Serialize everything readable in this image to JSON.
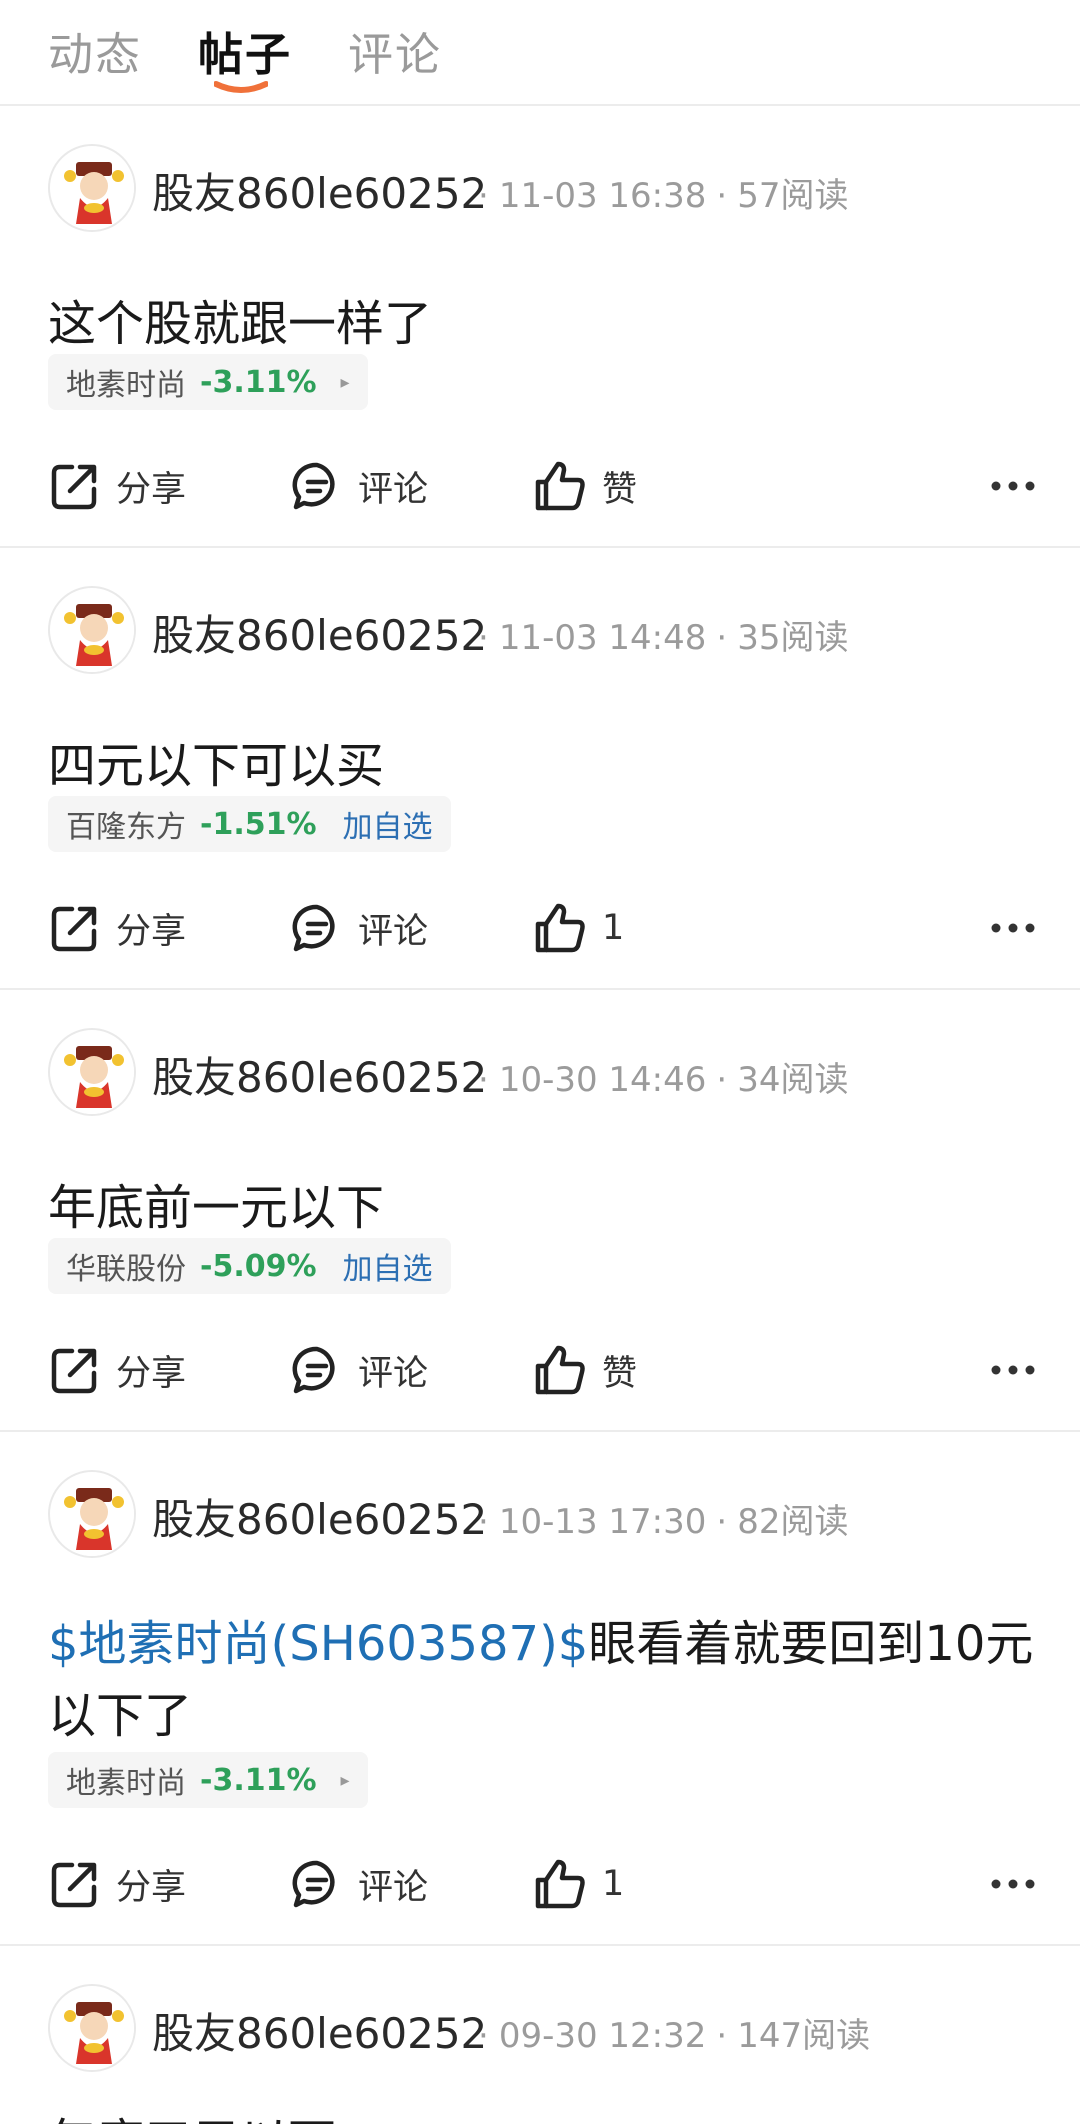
{
  "tabs": [
    {
      "label": "动态",
      "active": false
    },
    {
      "label": "帖子",
      "active": true
    },
    {
      "label": "评论",
      "active": false
    }
  ],
  "accent_color": "#f0713a",
  "posts": [
    {
      "author": "股友860le60252",
      "time": "11-03 16:38",
      "reads": "57阅读",
      "content_link": "",
      "content": "这个股就跟一样了",
      "stock": {
        "name": "地素时尚",
        "change": "-3.11%",
        "extra": "▸"
      },
      "actions": {
        "share": "分享",
        "comment": "评论",
        "like": "赞"
      }
    },
    {
      "author": "股友860le60252",
      "time": "11-03 14:48",
      "reads": "35阅读",
      "content_link": "",
      "content": "四元以下可以买",
      "stock": {
        "name": "百隆东方",
        "change": "-1.51%",
        "extra": "加自选"
      },
      "actions": {
        "share": "分享",
        "comment": "评论",
        "like": "1"
      }
    },
    {
      "author": "股友860le60252",
      "time": "10-30 14:46",
      "reads": "34阅读",
      "content_link": "",
      "content": "年底前一元以下",
      "stock": {
        "name": "华联股份",
        "change": "-5.09%",
        "extra": "加自选"
      },
      "actions": {
        "share": "分享",
        "comment": "评论",
        "like": "赞"
      }
    },
    {
      "author": "股友860le60252",
      "time": "10-13 17:30",
      "reads": "82阅读",
      "content_link": "$地素时尚(SH603587)$",
      "content": "眼看着就要回到10元以下了",
      "stock": {
        "name": "地素时尚",
        "change": "-3.11%",
        "extra": "▸"
      },
      "actions": {
        "share": "分享",
        "comment": "评论",
        "like": "1"
      }
    },
    {
      "author": "股友860le60252",
      "time": "09-30 12:32",
      "reads": "147阅读",
      "content_link": "",
      "content": "年底五元以下"
    }
  ]
}
